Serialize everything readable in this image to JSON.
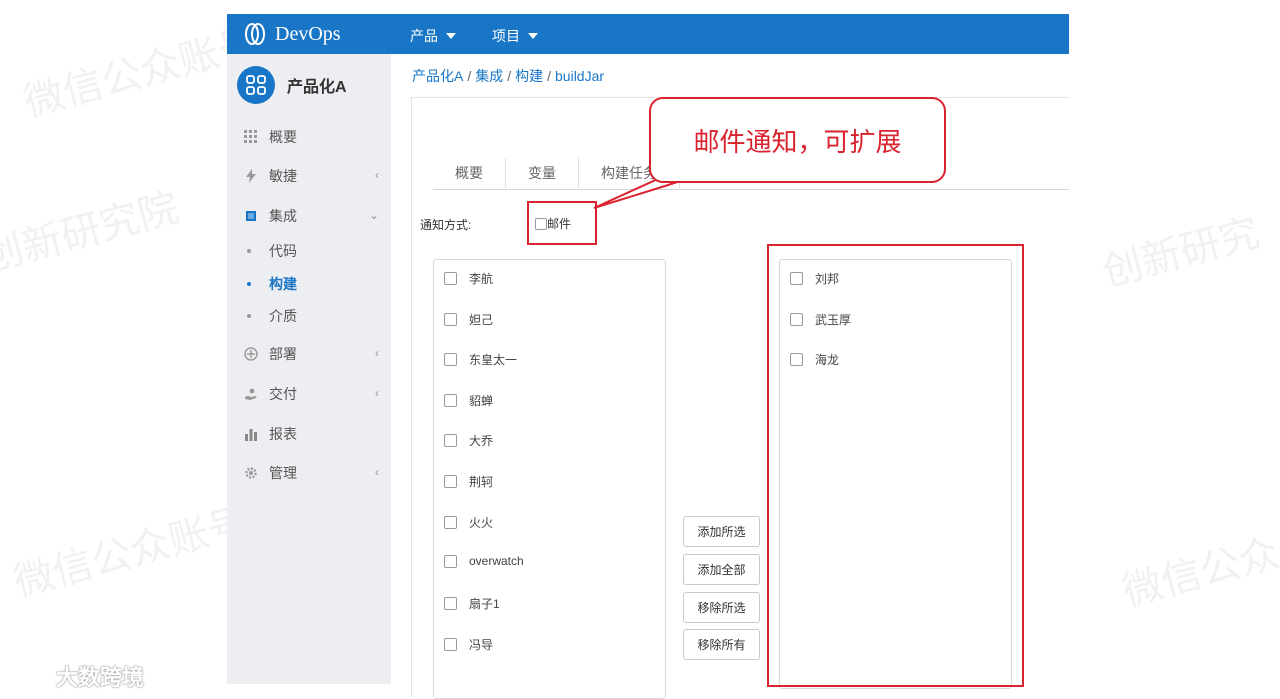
{
  "app": {
    "title": "DevOps"
  },
  "topnav": [
    {
      "label": "产品"
    },
    {
      "label": "项目"
    }
  ],
  "project": {
    "name": "产品化A"
  },
  "sidebar": {
    "items": [
      {
        "label": "概要",
        "icon": "grid-icon"
      },
      {
        "label": "敏捷",
        "icon": "lightning-icon"
      },
      {
        "label": "集成",
        "icon": "chip-icon"
      },
      {
        "label": "部署",
        "icon": "target-icon"
      },
      {
        "label": "交付",
        "icon": "hand-icon"
      },
      {
        "label": "报表",
        "icon": "bar-chart-icon"
      },
      {
        "label": "管理",
        "icon": "gear-icon"
      }
    ],
    "subitems": [
      {
        "label": "代码"
      },
      {
        "label": "构建"
      },
      {
        "label": "介质"
      }
    ]
  },
  "breadcrumb": [
    "产品化A",
    "集成",
    "构建",
    "buildJar"
  ],
  "tabs": [
    "概要",
    "变量",
    "构建任务"
  ],
  "notify": {
    "label": "通知方式:",
    "option": "邮件"
  },
  "available_users": [
    "李航",
    "妲己",
    "东皇太一",
    "貂蝉",
    "大乔",
    "荆轲",
    "火火",
    "overwatch",
    "扇子1",
    "冯导"
  ],
  "selected_users": [
    "刘邦",
    "武玉厚",
    "海龙"
  ],
  "buttons": {
    "add_selected": "添加所选",
    "add_all": "添加全部",
    "remove_selected": "移除所选",
    "remove_all": "移除所有"
  },
  "annotation": {
    "callout": "邮件通知，可扩展"
  },
  "watermarks": [
    "微信公众账号：eaworld",
    "EAI企业架构创新研究院"
  ],
  "footer": {
    "brand": "大数跨境"
  },
  "colors": {
    "primary": "#1976c6",
    "annotation": "#d9232e",
    "sidebar_bg": "#eceef1"
  }
}
